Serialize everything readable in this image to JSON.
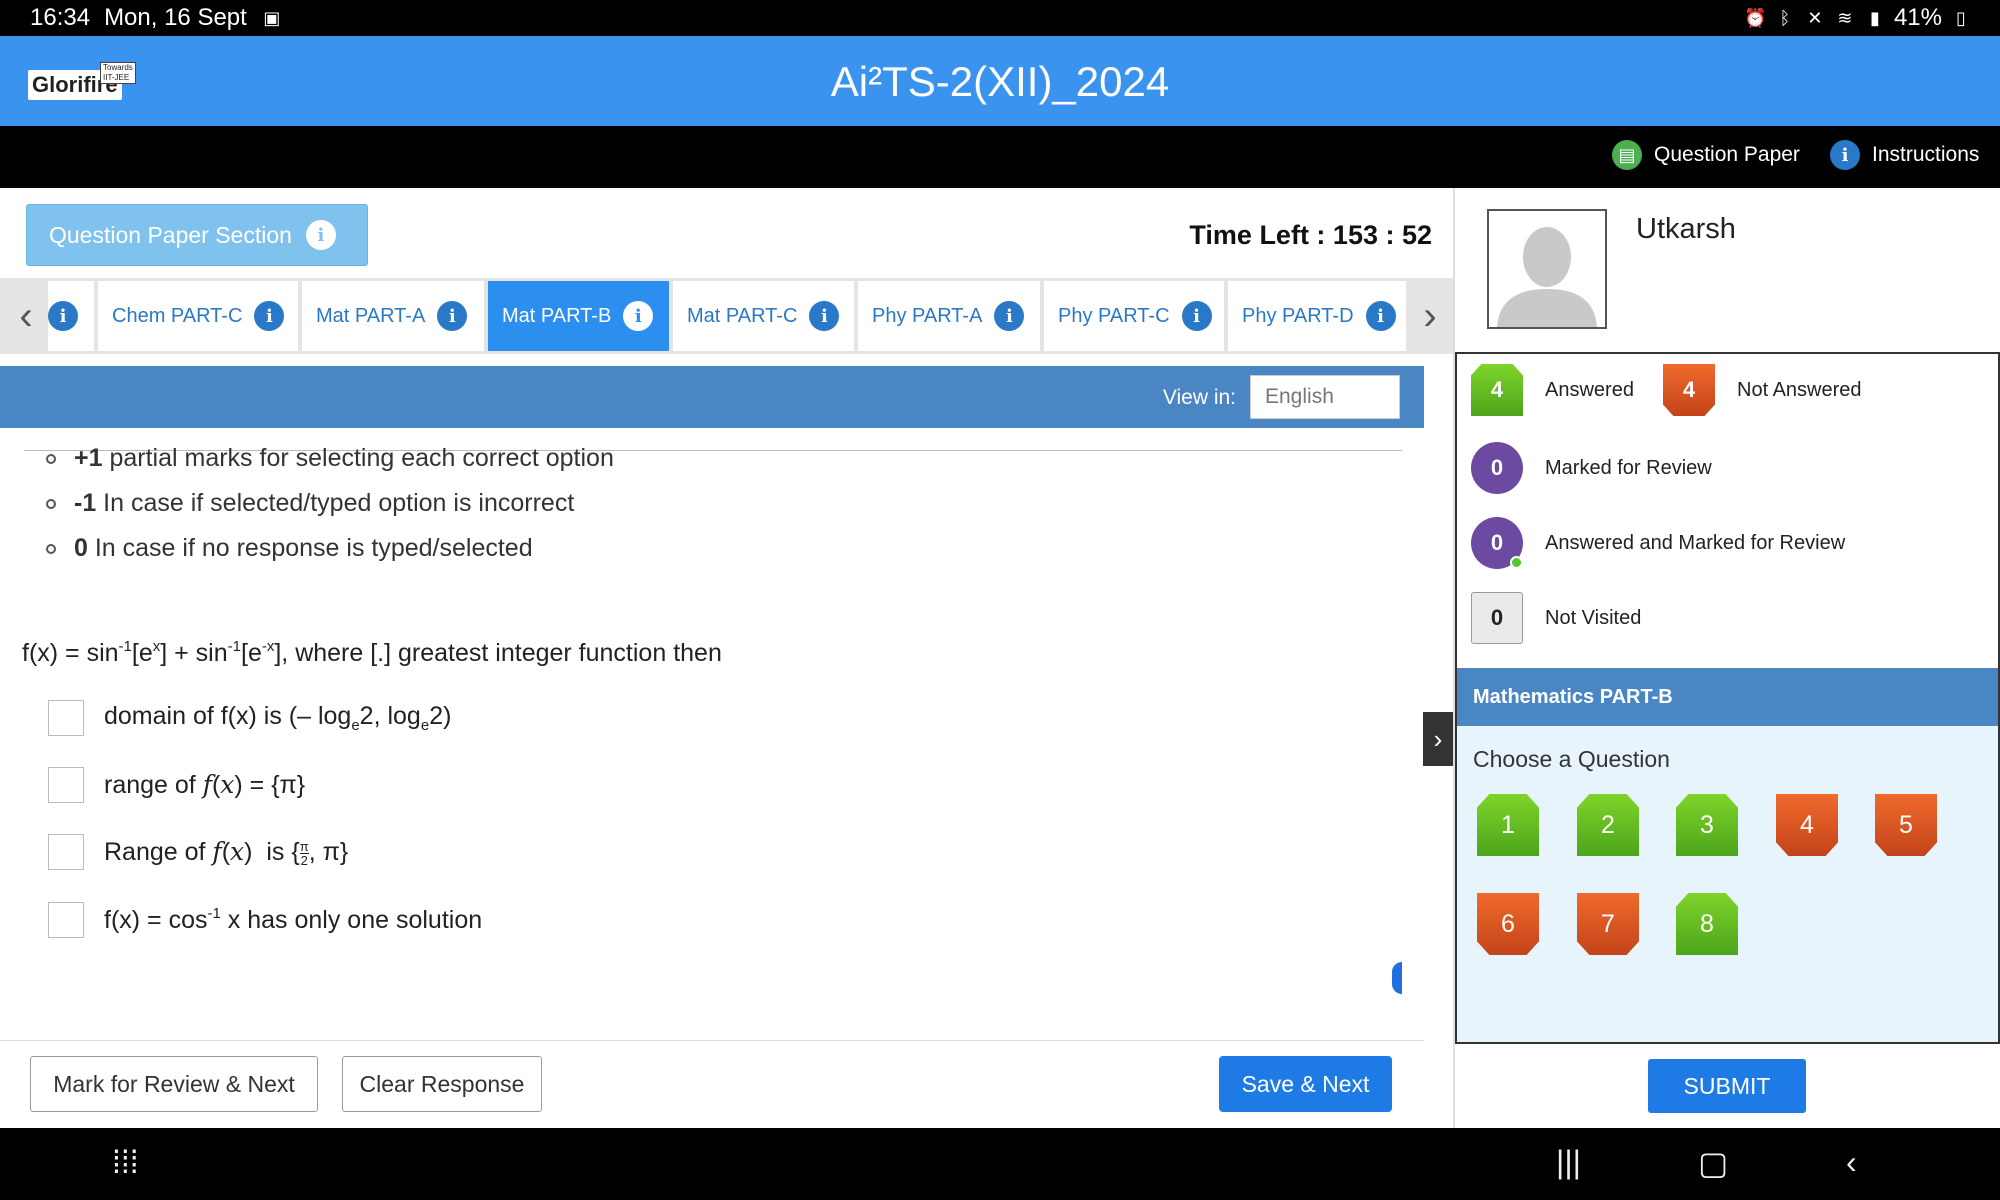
{
  "status_bar": {
    "time": "16:34",
    "date": "Mon, 16 Sept",
    "battery": "41%"
  },
  "header": {
    "logo": "Glorifire",
    "logo_tag": "Towards IIT-JEE",
    "title": "Ai²TS-2(XII)_2024"
  },
  "toolbar": {
    "question_paper": "Question Paper",
    "instructions": "Instructions"
  },
  "section_button": {
    "label": "Question Paper Section"
  },
  "timer": "Time Left : 153 : 52",
  "tabs": [
    {
      "label": "Chem PART-C"
    },
    {
      "label": "Mat PART-A"
    },
    {
      "label": "Mat PART-B"
    },
    {
      "label": "Mat PART-C"
    },
    {
      "label": "Phy PART-A"
    },
    {
      "label": "Phy PART-C"
    },
    {
      "label": "Phy PART-D"
    }
  ],
  "view_in": {
    "label": "View in:",
    "value": "English"
  },
  "marking": [
    {
      "bold": "+1",
      "text": " partial marks for selecting each correct option"
    },
    {
      "bold": "-1",
      "text": " In case if selected/typed option is incorrect"
    },
    {
      "bold": "0",
      "text": " In case if no response is typed/selected"
    }
  ],
  "question": {
    "text": "f(x) = sin-1[ex] + sin-1[e-x], where [.] greatest integer function then",
    "options": [
      "domain of f(x) is (– loge2, loge2)",
      "range of f(x) = {π}",
      "Range of f(x) is {π/2, π}",
      "f(x) = cos-1 x has only one solution"
    ]
  },
  "buttons": {
    "mark_review": "Mark for Review & Next",
    "clear": "Clear Response",
    "save_next": "Save & Next",
    "submit": "SUBMIT"
  },
  "user": {
    "name": "Utkarsh"
  },
  "legend": {
    "answered": {
      "count": "4",
      "label": "Answered"
    },
    "not_answered": {
      "count": "4",
      "label": "Not Answered"
    },
    "marked": {
      "count": "0",
      "label": "Marked for Review"
    },
    "answered_marked": {
      "count": "0",
      "label": "Answered and Marked for Review"
    },
    "not_visited": {
      "count": "0",
      "label": "Not Visited"
    }
  },
  "palette": {
    "section": "Mathematics PART-B",
    "choose": "Choose a Question",
    "questions": [
      {
        "n": "1",
        "status": "answered"
      },
      {
        "n": "2",
        "status": "answered"
      },
      {
        "n": "3",
        "status": "answered"
      },
      {
        "n": "4",
        "status": "not_answered"
      },
      {
        "n": "5",
        "status": "not_answered"
      },
      {
        "n": "6",
        "status": "not_answered"
      },
      {
        "n": "7",
        "status": "not_answered"
      },
      {
        "n": "8",
        "status": "answered"
      }
    ]
  },
  "colors": {
    "header_blue": "#3a94ef",
    "answered_green": "#5cb61f",
    "not_answered_red": "#d8501f",
    "review_purple": "#6d4aa2",
    "section_blue": "#4a86c4"
  }
}
